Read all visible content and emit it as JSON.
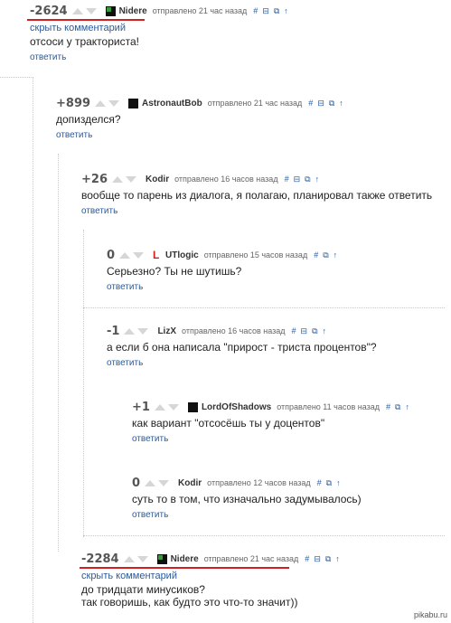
{
  "ui": {
    "up_arrow": "▲",
    "down_arrow": "▼"
  },
  "icons": {
    "link": "#",
    "minimize": "⊟",
    "copy": "⧉",
    "parent": "↑"
  },
  "comments": [
    {
      "score": "-2624",
      "author": "Nidere",
      "avatar": "green-avatar-icon",
      "time": "отправлено 21 час назад",
      "hide": "скрыть комментарий",
      "text": "отсоси у тракториста!",
      "reply": "ответить"
    },
    {
      "score": "+899",
      "author": "AstronautBob",
      "avatar": "astronaut-avatar-icon",
      "time": "отправлено 21 час назад",
      "text": "допизделся?",
      "reply": "ответить"
    },
    {
      "score": "+26",
      "author": "Kodir",
      "time": "отправлено 16 часов назад",
      "text": "вообще то парень из диалога, я полагаю, планировал также ответить",
      "reply": "ответить"
    },
    {
      "score": "0",
      "author": "UTlogic",
      "avatar": "red-l-avatar-icon",
      "time": "отправлено 15 часов назад",
      "text": "Серьезно? Ты не шутишь?",
      "reply": "ответить"
    },
    {
      "score": "-1",
      "author": "LizX",
      "time": "отправлено 16 часов назад",
      "text": "а если б она написала \"прирост - триста процентов\"?",
      "reply": "ответить"
    },
    {
      "score": "+1",
      "author": "LordOfShadows",
      "avatar": "dark-avatar-icon",
      "time": "отправлено 11 часов назад",
      "text": "как вариант \"отсосёшь ты у доцентов\"",
      "reply": "ответить"
    },
    {
      "score": "0",
      "author": "Kodir",
      "time": "отправлено 12 часов назад",
      "text": "суть то в том, что изначально задумывалось)",
      "reply": "ответить"
    },
    {
      "score": "-2284",
      "author": "Nidere",
      "avatar": "green-avatar-icon",
      "time": "отправлено 21 час назад",
      "hide": "скрыть комментарий",
      "text1": "до тридцати минусиков?",
      "text2": "так говоришь, как будто это что-то значит))"
    }
  ],
  "watermark": "pikabu.ru"
}
